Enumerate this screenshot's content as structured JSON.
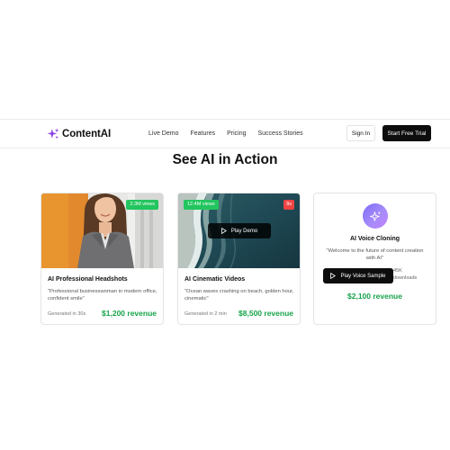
{
  "nav": {
    "logo_text": "ContentAI",
    "links": [
      "Live Demo",
      "Features",
      "Pricing",
      "Success Stories"
    ],
    "signin_label": "Sign In",
    "trial_label": "Start Free Trial"
  },
  "section": {
    "title": "See AI in Action"
  },
  "cards": [
    {
      "views": "2.3M views",
      "title": "AI Professional Headshots",
      "description": "\"Professional businesswoman in modern office, confident smile\"",
      "generated": "Generated in 30s",
      "revenue": "$1,200 revenue"
    },
    {
      "views": "12.4M views",
      "speed": "8s",
      "play_label": "Play Demo",
      "title": "AI Cinematic Videos",
      "description": "\"Ocean waves crashing on beach, golden hour, cinematic\"",
      "generated": "Generated in 2 min",
      "revenue": "$8,500 revenue"
    },
    {
      "title": "AI Voice Cloning",
      "quote": "\"Welcome to the future of content creation with AI\"",
      "play_label": "Play Voice Sample",
      "stat_value": "45K",
      "stat_label": "downloads",
      "revenue": "$2,100 revenue"
    }
  ],
  "colors": {
    "accent_green": "#16a34a",
    "badge_green": "#22c55e",
    "badge_red": "#ef4444",
    "brand_purple": "#8b5cf6",
    "dark_button": "#0d0d0d"
  },
  "icons": [
    "sparkles-logo-icon",
    "play-icon",
    "sparkles-icon"
  ]
}
